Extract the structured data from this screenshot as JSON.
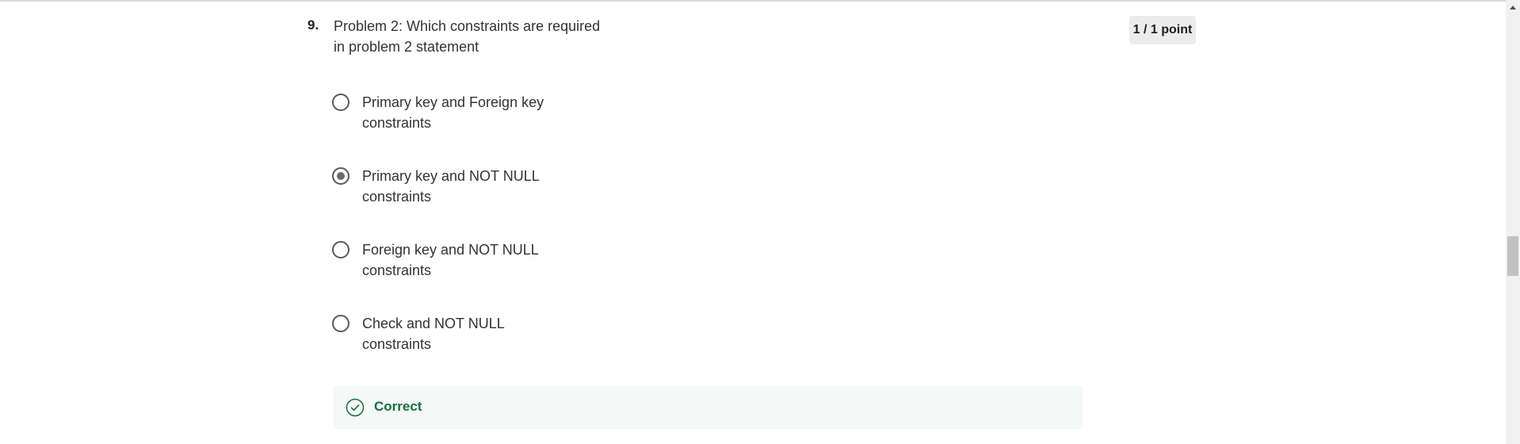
{
  "question": {
    "number": "9.",
    "text": "Problem 2: Which constraints are required in problem 2 statement",
    "points": "1 / 1 point"
  },
  "options": [
    {
      "label": "Primary key and Foreign key constraints",
      "selected": false
    },
    {
      "label": "Primary key and NOT NULL constraints",
      "selected": true
    },
    {
      "label": "Foreign key and NOT NULL constraints",
      "selected": false
    },
    {
      "label": "Check and NOT NULL constraints",
      "selected": false
    }
  ],
  "feedback": {
    "status": "Correct",
    "icon": "check-circle-icon",
    "color": "#1a6b45"
  }
}
